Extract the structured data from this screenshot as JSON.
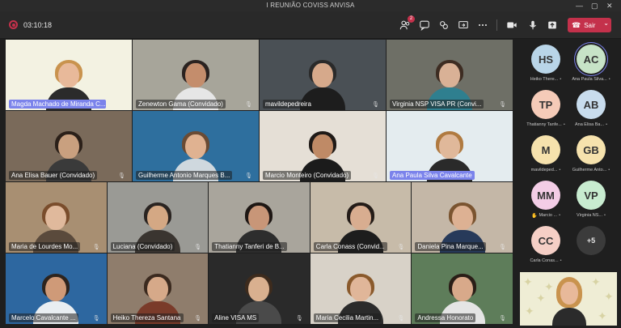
{
  "window": {
    "title": "I REUNIÃO COVISS ANVISA",
    "controls": [
      "—",
      "▢",
      "✕"
    ]
  },
  "toolbar": {
    "timer": "03:10:18",
    "participants_badge": "2",
    "leave_label": "Sair",
    "accent": "#c4314b"
  },
  "tiles": [
    {
      "name": "Magda Machado de Miranda C...",
      "highlight": true,
      "bg": "#f3f2e2",
      "skin": "#e8b99a",
      "hair": "#c9934e",
      "shirt": "#2b2b2b",
      "muted": false
    },
    {
      "name": "Zenewton Gama (Convidado)",
      "highlight": false,
      "bg": "#a7a59a",
      "skin": "#c48d6c",
      "hair": "#2a2220",
      "shirt": "#e6e6e6",
      "muted": true
    },
    {
      "name": "mavildepedreira",
      "highlight": false,
      "bg": "#4a5055",
      "skin": "#d6a98b",
      "hair": "#2a2a2a",
      "shirt": "#1d1d1d",
      "muted": true
    },
    {
      "name": "Virginia NSP VISA PR (Convi...",
      "highlight": false,
      "bg": "#6e6f66",
      "skin": "#d9b196",
      "hair": "#3d2c22",
      "shirt": "#2f7f8f",
      "muted": true
    },
    {
      "name": "Ana Elisa Bauer (Convidado)",
      "highlight": false,
      "bg": "#7a6a5a",
      "skin": "#c9a07f",
      "hair": "#2b2019",
      "shirt": "#3a3a3a",
      "muted": true
    },
    {
      "name": "Guilherme Antonio Marques B...",
      "highlight": false,
      "bg": "#2e6f9e",
      "skin": "#e0b291",
      "hair": "#6a4b34",
      "shirt": "#cfd8de",
      "muted": true
    },
    {
      "name": "Marcio Monteiro (Convidado)",
      "highlight": false,
      "bg": "#e5dfd6",
      "skin": "#bf8a66",
      "hair": "#1f1a17",
      "shirt": "#1b1b1b",
      "muted": true
    },
    {
      "name": "Ana Paula Silva Cavalcante",
      "highlight": true,
      "bg": "#e4ecef",
      "skin": "#e0b89a",
      "hair": "#b07a40",
      "shirt": "#2a2a2a",
      "muted": false
    },
    {
      "name": "Maria de Lourdes Mo...",
      "highlight": false,
      "bg": "#a88f72",
      "skin": "#e0b99c",
      "hair": "#7a4d2c",
      "shirt": "#5a4a3c",
      "muted": true
    },
    {
      "name": "Luciana (Convidado)",
      "highlight": false,
      "bg": "#9a9a95",
      "skin": "#d4a884",
      "hair": "#2a2421",
      "shirt": "#3a3530",
      "muted": true
    },
    {
      "name": "Thatianny Tanferi de B...",
      "highlight": false,
      "bg": "#a9a59c",
      "skin": "#c89678",
      "hair": "#1e1714",
      "shirt": "#2d2d2d",
      "muted": false
    },
    {
      "name": "Carla Conass (Convid...",
      "highlight": false,
      "bg": "#c7bba9",
      "skin": "#d8ad90",
      "hair": "#241c18",
      "shirt": "#1d1d1d",
      "muted": true
    },
    {
      "name": "Daniela Pina Marque...",
      "highlight": false,
      "bg": "#c4b7a7",
      "skin": "#ddb193",
      "hair": "#7a5430",
      "shirt": "#273a5a",
      "muted": true
    },
    {
      "name": "Marcelo Cavalcante ...",
      "highlight": false,
      "bg": "#2d67a0",
      "skin": "#cf9a78",
      "hair": "#2d241e",
      "shirt": "#e9eef2",
      "muted": true
    },
    {
      "name": "Heiko Thereza Santana",
      "highlight": false,
      "bg": "#8f7d6c",
      "skin": "#d6a989",
      "hair": "#3b2a1f",
      "shirt": "#7a3b2a",
      "muted": true
    },
    {
      "name": "Aline VISA MS",
      "highlight": false,
      "bg": "#2a2a2a",
      "skin": "#d9b08f",
      "hair": "#3d2b1d",
      "shirt": "#4a4a4a",
      "muted": true
    },
    {
      "name": "Maria Cecilia  Martin...",
      "highlight": false,
      "bg": "#d8d2c8",
      "skin": "#e0b699",
      "hair": "#8a5a2c",
      "shirt": "#2b2b2b",
      "muted": true
    },
    {
      "name": "Andressa Honorato",
      "highlight": false,
      "bg": "#5e7d5a",
      "skin": "#d8a98a",
      "hair": "#2a1e17",
      "shirt": "#e5e5e5",
      "muted": true
    }
  ],
  "roster": [
    {
      "initials": "HS",
      "name": "Heiko There...",
      "color": "#b9d5e8",
      "ring": false
    },
    {
      "initials": "AC",
      "name": "Ana Paula Silva...",
      "color": "#c7e3c7",
      "ring": true
    },
    {
      "initials": "TP",
      "name": "Thatianny Tanfe...",
      "color": "#f5cbb8",
      "ring": false
    },
    {
      "initials": "AB",
      "name": "Ana Elisa Ba...",
      "color": "#c8dced",
      "ring": false
    },
    {
      "initials": "M",
      "name": "mavildeped...",
      "color": "#f6e2ad",
      "ring": false
    },
    {
      "initials": "GB",
      "name": "Guilherme Anto...",
      "color": "#f6e2ad",
      "ring": false
    },
    {
      "initials": "MM",
      "name": "Marcio ...",
      "color": "#f3cde6",
      "ring": false,
      "hand": true
    },
    {
      "initials": "VP",
      "name": "Virginia NS...",
      "color": "#c8ecd0",
      "ring": false
    },
    {
      "initials": "CC",
      "name": "Carla Conas...",
      "color": "#f5cfc6",
      "ring": false
    },
    {
      "initials": "+5",
      "name": "",
      "color": "#3b3b3b",
      "ring": false,
      "more": true
    }
  ]
}
